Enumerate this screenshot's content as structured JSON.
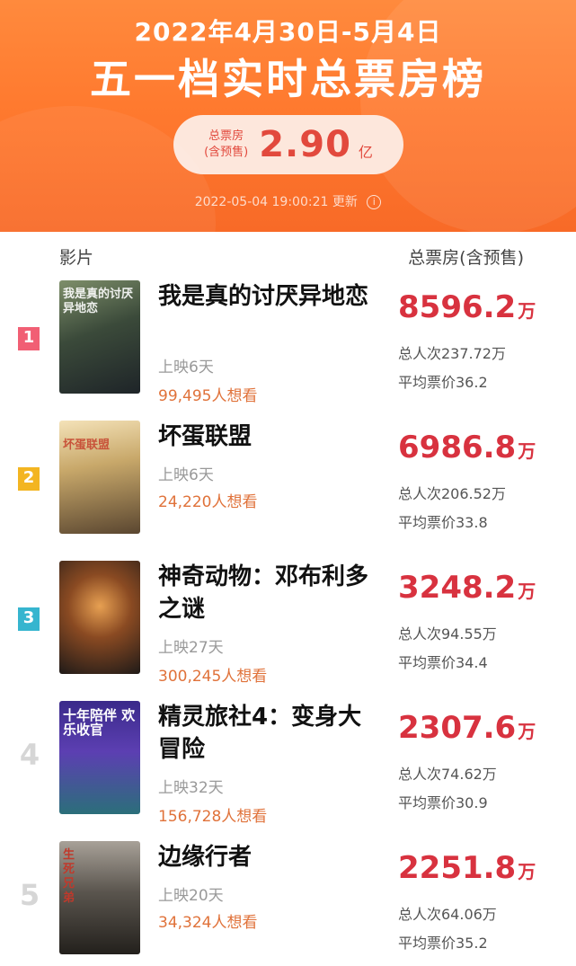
{
  "header": {
    "date_range": "2022年4月30日-5月4日",
    "title": "五一档实时总票房榜",
    "total_label_line1": "总票房",
    "total_label_line2": "(含预售)",
    "total_value": "2.90",
    "total_unit": "亿",
    "update_time": "2022-05-04 19:00:21 更新",
    "info_icon": "i"
  },
  "columns": {
    "film": "影片",
    "box_office": "总票房(含预售)"
  },
  "colors": {
    "accent": "#ff7a2f",
    "box_red": "#d8323f",
    "want_orange": "#e0723a"
  },
  "movies": [
    {
      "rank": "1",
      "title": "我是真的讨厌异地恋",
      "days": "上映6天",
      "want": "99,495人想看",
      "box": "8596.2",
      "unit": "万",
      "audience": "总人次237.72万",
      "avg_price": "平均票价36.2",
      "poster_text": "我是真的讨厌异地恋"
    },
    {
      "rank": "2",
      "title": "坏蛋联盟",
      "days": "上映6天",
      "want": "24,220人想看",
      "box": "6986.8",
      "unit": "万",
      "audience": "总人次206.52万",
      "avg_price": "平均票价33.8",
      "poster_text": "坏蛋联盟"
    },
    {
      "rank": "3",
      "title": "神奇动物：邓布利多之谜",
      "days": "上映27天",
      "want": "300,245人想看",
      "box": "3248.2",
      "unit": "万",
      "audience": "总人次94.55万",
      "avg_price": "平均票价34.4",
      "poster_text": ""
    },
    {
      "rank": "4",
      "title": "精灵旅社4：变身大冒险",
      "days": "上映32天",
      "want": "156,728人想看",
      "box": "2307.6",
      "unit": "万",
      "audience": "总人次74.62万",
      "avg_price": "平均票价30.9",
      "poster_text": "十年陪伴 欢乐收官"
    },
    {
      "rank": "5",
      "title": "边缘行者",
      "days": "上映20天",
      "want": "34,324人想看",
      "box": "2251.8",
      "unit": "万",
      "audience": "总人次64.06万",
      "avg_price": "平均票价35.2",
      "poster_text": "生死兄弟"
    }
  ]
}
